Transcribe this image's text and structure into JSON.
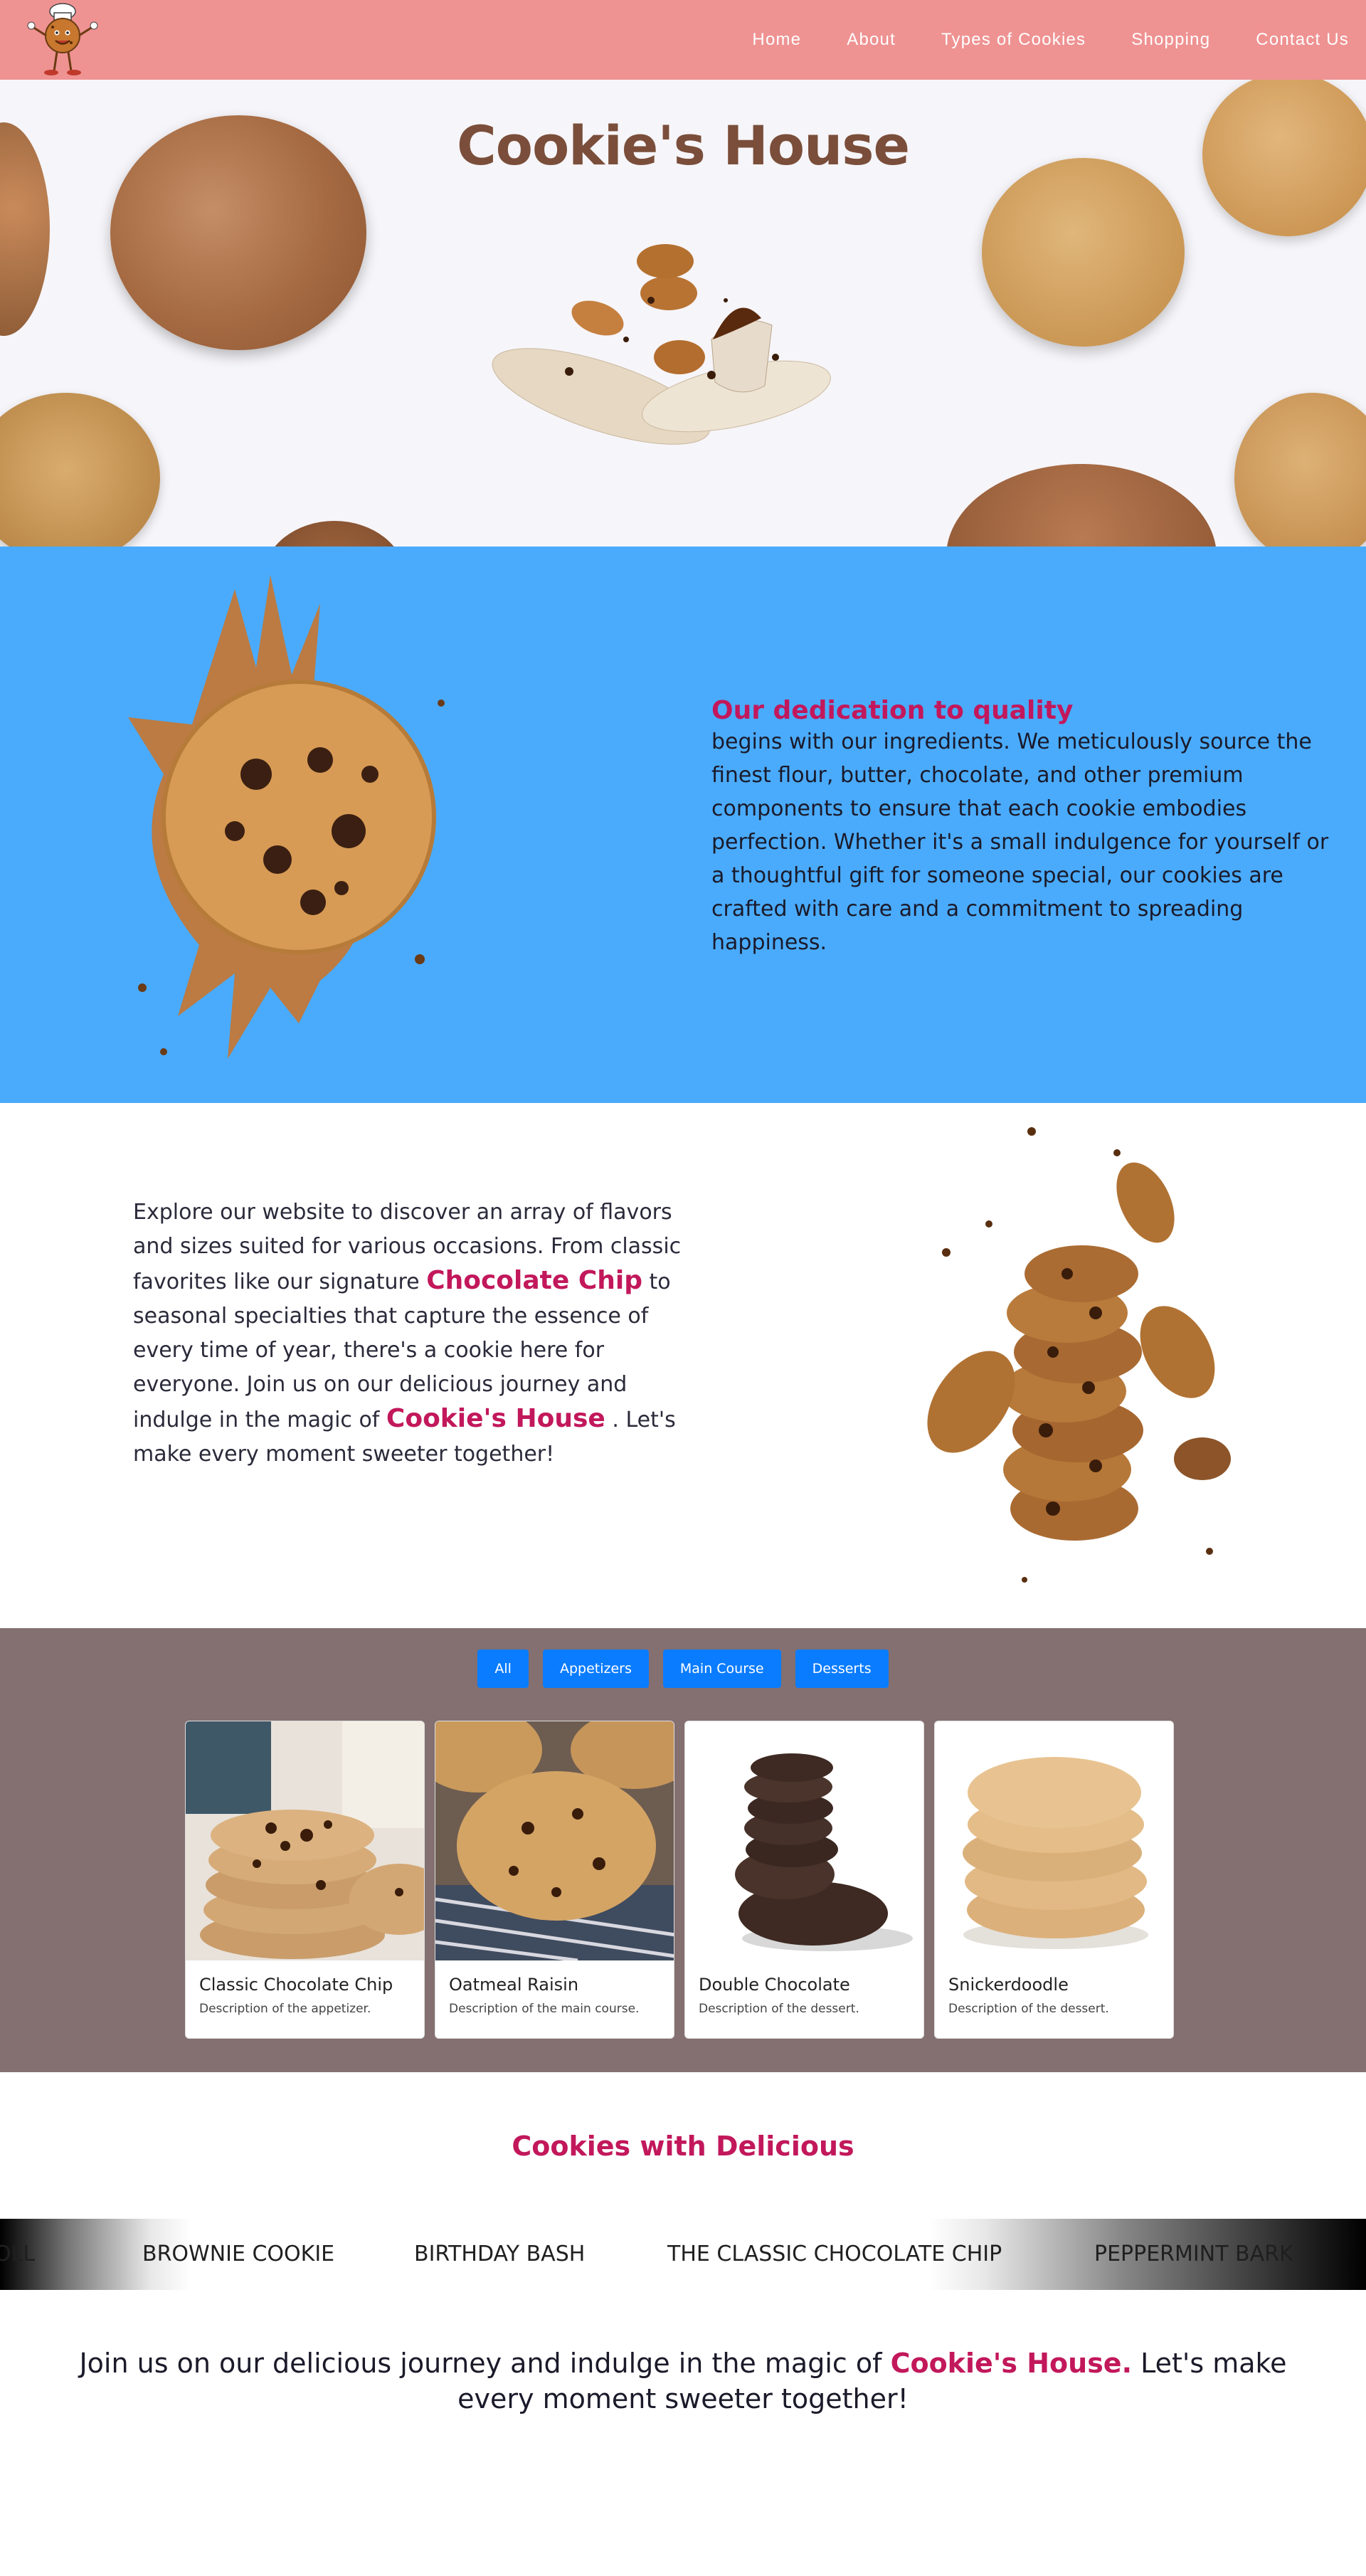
{
  "navbar": {
    "logo_icon": "chef-cookie-mascot-icon",
    "links": [
      "Home",
      "About",
      "Types of Cookies",
      "Shopping",
      "Contact Us"
    ],
    "background": "#ef9292"
  },
  "hero": {
    "title": "Cookie's House",
    "title_color": "#7a4e3a",
    "image_icon": "flying-cookies-coffee-cup-icon"
  },
  "quality": {
    "heading": "Our dedication to quality",
    "body": "begins with our ingredients. We meticulously source the finest flour, butter, chocolate, and other premium components to ensure that each cookie embodies perfection. Whether it's a small indulgence for yourself or a thoughtful gift for someone special, our cookies are crafted with care and a commitment to spreading happiness.",
    "image_icon": "chocolate-chip-cookie-splash-icon",
    "background": "#4aabfc"
  },
  "explore": {
    "part1": "Explore our website to discover an array of flavors and sizes suited for various occasions. From classic favorites like our signature",
    "highlight1": "Chocolate Chip",
    "part2": "to seasonal specialties that capture the essence of every time of year, there's a cookie here for everyone. Join us on our delicious journey and indulge in the magic of",
    "highlight2": "Cookie's House",
    "part3": ". Let's make every moment sweeter together!",
    "image_icon": "stacked-cookies-crumbs-icon"
  },
  "menu": {
    "filters": [
      "All",
      "Appetizers",
      "Main Course",
      "Desserts"
    ],
    "items": [
      {
        "title": "Classic Chocolate Chip",
        "description": "Description of the appetizer.",
        "image_icon": "chocolate-chip-cookie-stack-icon"
      },
      {
        "title": "Oatmeal Raisin",
        "description": "Description of the main course.",
        "image_icon": "oatmeal-raisin-cookie-icon"
      },
      {
        "title": "Double Chocolate",
        "description": "Description of the dessert.",
        "image_icon": "double-chocolate-cookie-stack-icon"
      },
      {
        "title": "Snickerdoodle",
        "description": "Description of the dessert.",
        "image_icon": "snickerdoodle-cookie-stack-icon"
      }
    ],
    "background": "#847070",
    "button_color": "#0a7cff"
  },
  "delicious": {
    "title": "Cookies with Delicious"
  },
  "marquee": {
    "items": [
      "OLL",
      "BROWNIE COOKIE",
      "BIRTHDAY BASH",
      "THE CLASSIC CHOCOLATE CHIP",
      "PEPPERMINT BARK"
    ]
  },
  "closing": {
    "part1": "Join us on our delicious journey and indulge in the magic of",
    "highlight": "Cookie's House.",
    "part2": "Let's make every moment sweeter together!"
  }
}
